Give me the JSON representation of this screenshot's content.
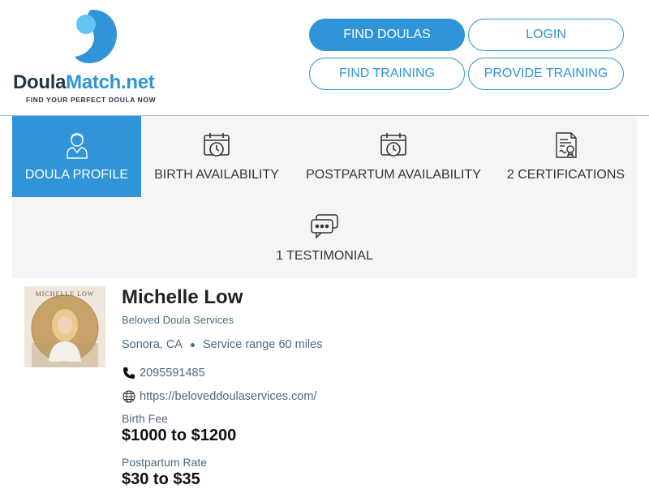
{
  "logo": {
    "name_part1": "Doula",
    "name_part2": "Match.net",
    "tagline": "FIND YOUR PERFECT DOULA NOW"
  },
  "nav": {
    "find_doulas": "FIND DOULAS",
    "login": "LOGIN",
    "find_training": "FIND TRAINING",
    "provide_training": "PROVIDE TRAINING"
  },
  "tabs": [
    {
      "label": "DOULA PROFILE",
      "icon": "doula-person-icon",
      "active": true
    },
    {
      "label": "BIRTH AVAILABILITY",
      "icon": "calendar-clock-icon",
      "active": false
    },
    {
      "label": "POSTPARTUM AVAILABILITY",
      "icon": "calendar-clock-icon",
      "active": false
    },
    {
      "label": "2 CERTIFICATIONS",
      "icon": "certificate-icon",
      "active": false
    },
    {
      "label": "1 TESTIMONIAL",
      "icon": "chat-bubbles-icon",
      "active": false
    }
  ],
  "profile": {
    "avatar_text": "MICHELLE LOW",
    "name": "Michelle Low",
    "agency": "Beloved Doula Services",
    "city": "Sonora, CA",
    "service_range": "Service range 60 miles",
    "phone": "2095591485",
    "website": "https://beloveddoulaservices.com/",
    "birth_fee_label": "Birth Fee",
    "birth_fee_value": "$1000 to $1200",
    "postpartum_rate_label": "Postpartum Rate",
    "postpartum_rate_value": "$30 to $35"
  },
  "colors": {
    "brand_blue": "#2f94d8",
    "dark_navy": "#27354a",
    "muted_text": "#4a6a85",
    "tab_bg": "#f5f5f5"
  }
}
